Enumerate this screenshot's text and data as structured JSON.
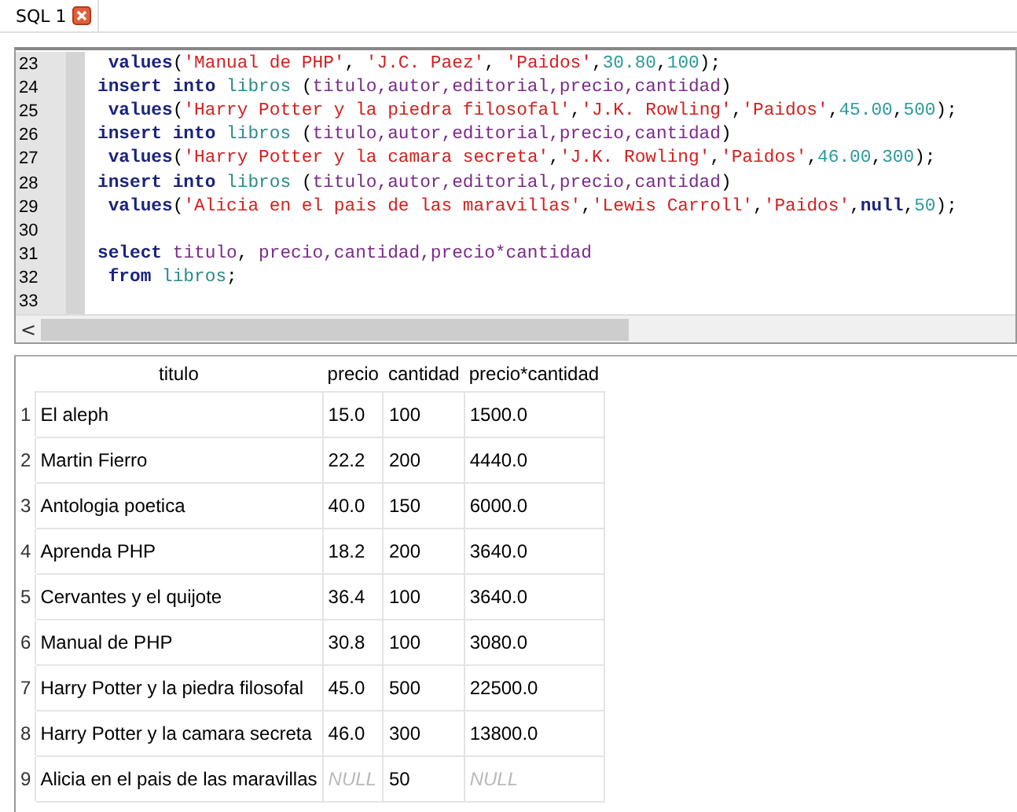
{
  "tab": {
    "label": "SQL 1",
    "selected": true
  },
  "editor": {
    "lines": [
      {
        "number": "23",
        "tokens": [
          {
            "kind": "kw",
            "text": " values"
          },
          {
            "kind": "p",
            "text": "("
          },
          {
            "kind": "str",
            "text": "'Manual de PHP'"
          },
          {
            "kind": "p",
            "text": ", "
          },
          {
            "kind": "str",
            "text": "'J.C. Paez'"
          },
          {
            "kind": "p",
            "text": ", "
          },
          {
            "kind": "str",
            "text": "'Paidos'"
          },
          {
            "kind": "p",
            "text": ","
          },
          {
            "kind": "num",
            "text": "30.80"
          },
          {
            "kind": "p",
            "text": ","
          },
          {
            "kind": "num",
            "text": "100"
          },
          {
            "kind": "p",
            "text": ");"
          }
        ]
      },
      {
        "number": "24",
        "tokens": [
          {
            "kind": "kw",
            "text": "insert into "
          },
          {
            "kind": "table",
            "text": "libros"
          },
          {
            "kind": "p",
            "text": " ("
          },
          {
            "kind": "col",
            "text": "titulo,autor,editorial,precio,cantidad"
          },
          {
            "kind": "p",
            "text": ")"
          }
        ]
      },
      {
        "number": "25",
        "tokens": [
          {
            "kind": "kw",
            "text": " values"
          },
          {
            "kind": "p",
            "text": "("
          },
          {
            "kind": "str",
            "text": "'Harry Potter y la piedra filosofal'"
          },
          {
            "kind": "p",
            "text": ","
          },
          {
            "kind": "str",
            "text": "'J.K. Rowling'"
          },
          {
            "kind": "p",
            "text": ","
          },
          {
            "kind": "str",
            "text": "'Paidos'"
          },
          {
            "kind": "p",
            "text": ","
          },
          {
            "kind": "num",
            "text": "45.00"
          },
          {
            "kind": "p",
            "text": ","
          },
          {
            "kind": "num",
            "text": "500"
          },
          {
            "kind": "p",
            "text": ");"
          }
        ]
      },
      {
        "number": "26",
        "tokens": [
          {
            "kind": "kw",
            "text": "insert into "
          },
          {
            "kind": "table",
            "text": "libros"
          },
          {
            "kind": "p",
            "text": " ("
          },
          {
            "kind": "col",
            "text": "titulo,autor,editorial,precio,cantidad"
          },
          {
            "kind": "p",
            "text": ")"
          }
        ]
      },
      {
        "number": "27",
        "tokens": [
          {
            "kind": "kw",
            "text": " values"
          },
          {
            "kind": "p",
            "text": "("
          },
          {
            "kind": "str",
            "text": "'Harry Potter y la camara secreta'"
          },
          {
            "kind": "p",
            "text": ","
          },
          {
            "kind": "str",
            "text": "'J.K. Rowling'"
          },
          {
            "kind": "p",
            "text": ","
          },
          {
            "kind": "str",
            "text": "'Paidos'"
          },
          {
            "kind": "p",
            "text": ","
          },
          {
            "kind": "num",
            "text": "46.00"
          },
          {
            "kind": "p",
            "text": ","
          },
          {
            "kind": "num",
            "text": "300"
          },
          {
            "kind": "p",
            "text": ");"
          }
        ]
      },
      {
        "number": "28",
        "tokens": [
          {
            "kind": "kw",
            "text": "insert into "
          },
          {
            "kind": "table",
            "text": "libros"
          },
          {
            "kind": "p",
            "text": " ("
          },
          {
            "kind": "col",
            "text": "titulo,autor,editorial,precio,cantidad"
          },
          {
            "kind": "p",
            "text": ")"
          }
        ]
      },
      {
        "number": "29",
        "tokens": [
          {
            "kind": "kw",
            "text": " values"
          },
          {
            "kind": "p",
            "text": "("
          },
          {
            "kind": "str",
            "text": "'Alicia en el pais de las maravillas'"
          },
          {
            "kind": "p",
            "text": ","
          },
          {
            "kind": "str",
            "text": "'Lewis Carroll'"
          },
          {
            "kind": "p",
            "text": ","
          },
          {
            "kind": "str",
            "text": "'Paidos'"
          },
          {
            "kind": "p",
            "text": ","
          },
          {
            "kind": "kw",
            "text": "null"
          },
          {
            "kind": "p",
            "text": ","
          },
          {
            "kind": "num",
            "text": "50"
          },
          {
            "kind": "p",
            "text": ");"
          }
        ]
      },
      {
        "number": "30"
      },
      {
        "number": "31",
        "tokens": [
          {
            "kind": "kw",
            "text": "select "
          },
          {
            "kind": "col",
            "text": "titulo"
          },
          {
            "kind": "p",
            "text": ", "
          },
          {
            "kind": "col",
            "text": "precio,cantidad,precio*cantidad"
          }
        ]
      },
      {
        "number": "32",
        "tokens": [
          {
            "kind": "kw",
            "text": " from "
          },
          {
            "kind": "table",
            "text": "libros"
          },
          {
            "kind": "p",
            "text": ";"
          }
        ]
      },
      {
        "number": "33"
      }
    ],
    "scroll_arrow": "<"
  },
  "results": {
    "columns": [
      "titulo",
      "precio",
      "cantidad",
      "precio*cantidad"
    ],
    "rows": [
      {
        "index": "1",
        "cells": [
          {
            "text": "El aleph",
            "null": false
          },
          {
            "text": "15.0",
            "null": false
          },
          {
            "text": "100",
            "null": false
          },
          {
            "text": "1500.0",
            "null": false
          }
        ]
      },
      {
        "index": "2",
        "cells": [
          {
            "text": "Martin Fierro",
            "null": false
          },
          {
            "text": "22.2",
            "null": false
          },
          {
            "text": "200",
            "null": false
          },
          {
            "text": "4440.0",
            "null": false
          }
        ]
      },
      {
        "index": "3",
        "cells": [
          {
            "text": "Antologia poetica",
            "null": false
          },
          {
            "text": "40.0",
            "null": false
          },
          {
            "text": "150",
            "null": false
          },
          {
            "text": "6000.0",
            "null": false
          }
        ]
      },
      {
        "index": "4",
        "cells": [
          {
            "text": "Aprenda PHP",
            "null": false
          },
          {
            "text": "18.2",
            "null": false
          },
          {
            "text": "200",
            "null": false
          },
          {
            "text": "3640.0",
            "null": false
          }
        ]
      },
      {
        "index": "5",
        "cells": [
          {
            "text": "Cervantes y el quijote",
            "null": false
          },
          {
            "text": "36.4",
            "null": false
          },
          {
            "text": "100",
            "null": false
          },
          {
            "text": "3640.0",
            "null": false
          }
        ]
      },
      {
        "index": "6",
        "cells": [
          {
            "text": "Manual de PHP",
            "null": false
          },
          {
            "text": "30.8",
            "null": false
          },
          {
            "text": "100",
            "null": false
          },
          {
            "text": "3080.0",
            "null": false
          }
        ]
      },
      {
        "index": "7",
        "cells": [
          {
            "text": "Harry Potter y la piedra filosofal",
            "null": false
          },
          {
            "text": "45.0",
            "null": false
          },
          {
            "text": "500",
            "null": false
          },
          {
            "text": "22500.0",
            "null": false
          }
        ]
      },
      {
        "index": "8",
        "cells": [
          {
            "text": "Harry Potter y la camara secreta",
            "null": false
          },
          {
            "text": "46.0",
            "null": false
          },
          {
            "text": "300",
            "null": false
          },
          {
            "text": "13800.0",
            "null": false
          }
        ]
      },
      {
        "index": "9",
        "cells": [
          {
            "text": "Alicia en el pais de las maravillas",
            "null": false
          },
          {
            "text": "NULL",
            "null": true
          },
          {
            "text": "50",
            "null": false
          },
          {
            "text": "NULL",
            "null": true
          }
        ]
      }
    ]
  }
}
